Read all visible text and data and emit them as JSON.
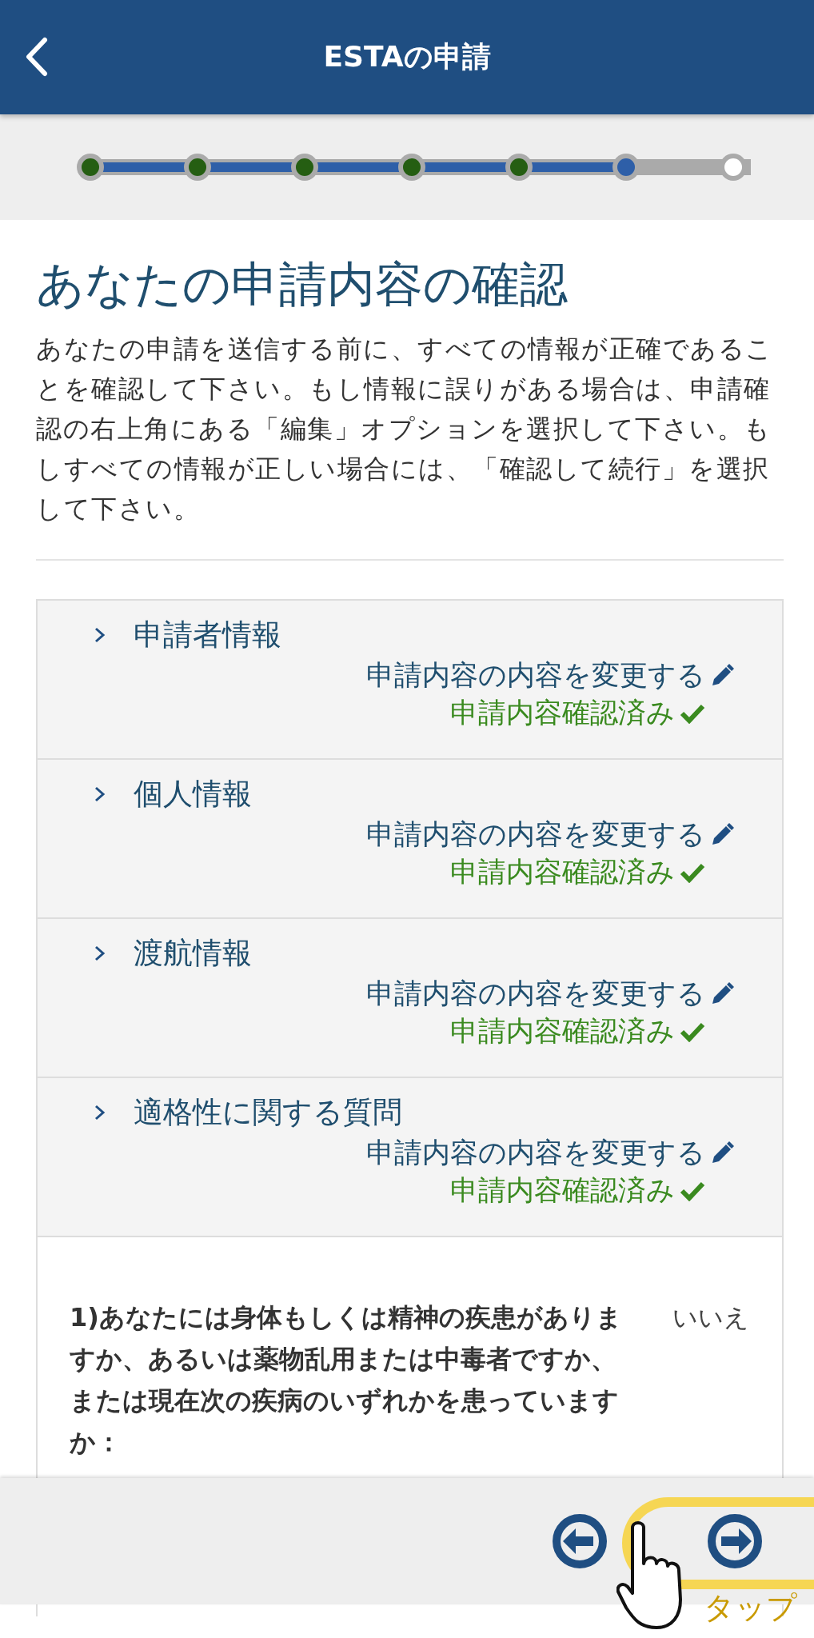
{
  "header": {
    "title": "ESTAの申請"
  },
  "steps": [
    {
      "completed": true,
      "current": false
    },
    {
      "completed": true,
      "current": false
    },
    {
      "completed": true,
      "current": false
    },
    {
      "completed": true,
      "current": false
    },
    {
      "completed": true,
      "current": false
    },
    {
      "completed": false,
      "current": true
    },
    {
      "completed": false,
      "current": false
    }
  ],
  "heading": "あなたの申請内容の確認",
  "intro": "あなたの申請を送信する前に、すべての情報が正確であることを確認して下さい。もし情報に誤りがある場合は、申請確認の右上角にある「編集」オプションを選択して下さい。もしすべての情報が正しい場合には、「確認して続行」を選択して下さい。",
  "sections": [
    {
      "title": "申請者情報",
      "edit_link": "申請内容の内容を変更する",
      "status": "申請内容確認済み",
      "expanded": false
    },
    {
      "title": "個人情報",
      "edit_link": "申請内容の内容を変更する",
      "status": "申請内容確認済み",
      "expanded": false
    },
    {
      "title": "渡航情報",
      "edit_link": "申請内容の内容を変更する",
      "status": "申請内容確認済み",
      "expanded": false
    },
    {
      "title": "適格性に関する質問",
      "edit_link": "申請内容の内容を変更する",
      "status": "申請内容確認済み",
      "expanded": false
    }
  ],
  "questions": [
    {
      "text": "1)あなたには身体もしくは精神の疾患がありますか、あるいは薬物乱用または中毒者ですか、または現在次の疾病のいずれかを患っていますか：",
      "answer": "いいえ"
    }
  ],
  "footer": {
    "tap_hint": "タップ"
  }
}
